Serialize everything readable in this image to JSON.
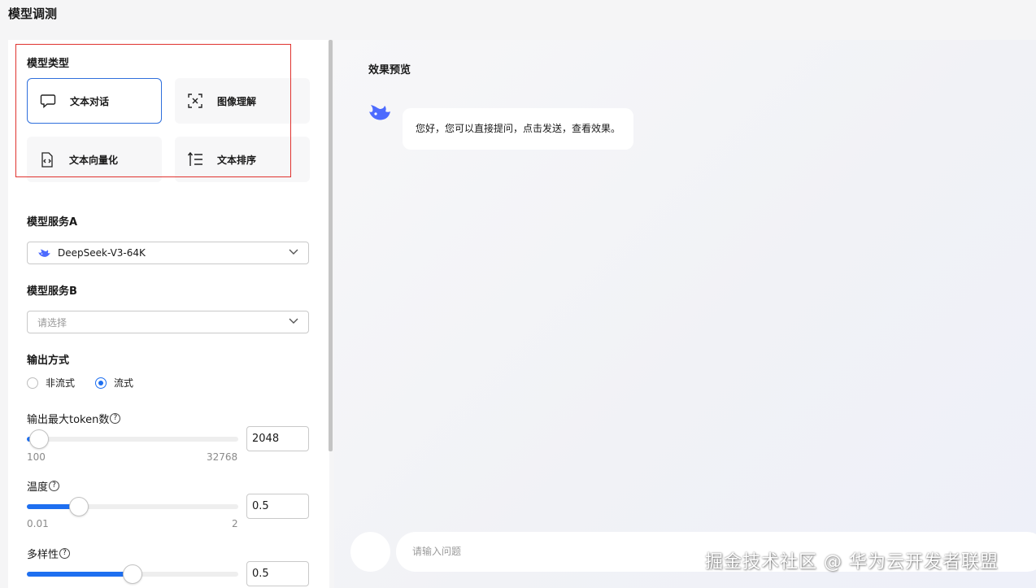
{
  "page_title": "模型调测",
  "model_type": {
    "label": "模型类型",
    "cards": [
      {
        "label": "文本对话",
        "icon": "chat-bubble-icon",
        "selected": true
      },
      {
        "label": "图像理解",
        "icon": "image-scan-icon",
        "selected": false
      },
      {
        "label": "文本向量化",
        "icon": "code-file-icon",
        "selected": false
      },
      {
        "label": "文本排序",
        "icon": "sort-list-icon",
        "selected": false
      }
    ]
  },
  "service_a": {
    "label": "模型服务A",
    "value": "DeepSeek-V3-64K",
    "icon": "deepseek-whale-icon"
  },
  "service_b": {
    "label": "模型服务B",
    "placeholder": "请选择"
  },
  "output_mode": {
    "label": "输出方式",
    "options": [
      {
        "label": "非流式",
        "selected": false
      },
      {
        "label": "流式",
        "selected": true
      }
    ]
  },
  "params": {
    "max_tokens": {
      "label": "输出最大token数",
      "help": "?",
      "min": "100",
      "max": "32768",
      "value": "2048",
      "fraction": 0.058
    },
    "temperature": {
      "label": "温度",
      "help": "?",
      "min": "0.01",
      "max": "2",
      "value": "0.5",
      "fraction": 0.246
    },
    "top_p": {
      "label": "多样性",
      "help": "?",
      "value": "0.5",
      "fraction": 0.5
    }
  },
  "preview": {
    "title": "效果预览",
    "bot_icon": "deepseek-whale-icon",
    "message": "您好，您可以直接提问，点击发送，查看效果。",
    "input_placeholder": "请输入问题"
  },
  "watermark": "掘金技术社区 @ 华为云开发者联盟",
  "colors": {
    "accent": "#1e6ff0",
    "highlight_border": "#e0332f",
    "brand": "#4d6bfe"
  }
}
